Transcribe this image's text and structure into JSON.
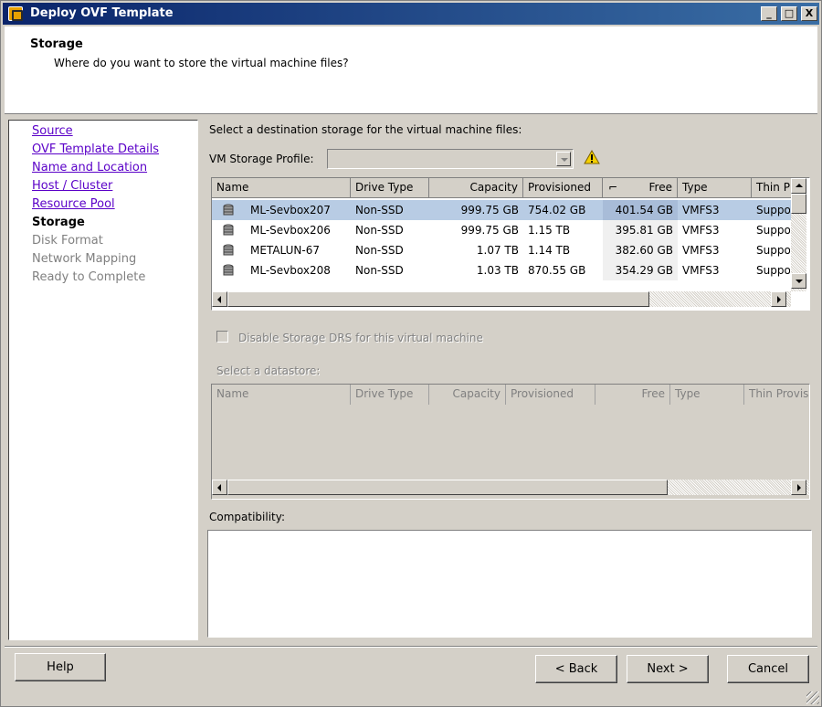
{
  "window": {
    "title": "Deploy OVF Template",
    "controls": [
      "_",
      "□",
      "X"
    ]
  },
  "header": {
    "title": "Storage",
    "subtitle": "Where do you want to store the virtual machine files?"
  },
  "nav": {
    "items": [
      {
        "label": "Source",
        "state": "link"
      },
      {
        "label": "OVF Template Details",
        "state": "link"
      },
      {
        "label": "Name and Location",
        "state": "link"
      },
      {
        "label": "Host / Cluster",
        "state": "link"
      },
      {
        "label": "Resource Pool",
        "state": "link"
      },
      {
        "label": "Storage",
        "state": "current"
      },
      {
        "label": "Disk Format",
        "state": "disabled"
      },
      {
        "label": "Network Mapping",
        "state": "disabled"
      },
      {
        "label": "Ready to Complete",
        "state": "disabled"
      }
    ]
  },
  "main": {
    "prompt": "Select a destination storage for the virtual machine files:",
    "profile_label": "VM Storage Profile:",
    "profile_value": "",
    "warning_icon": "warning-triangle-icon",
    "columns": [
      "Name",
      "Drive Type",
      "Capacity",
      "Provisioned",
      "Free",
      "Type",
      "Thin P"
    ],
    "rows": [
      {
        "name": "ML-Sevbox207",
        "drive": "Non-SSD",
        "capacity": "999.75 GB",
        "provisioned": "754.02 GB",
        "free": "401.54 GB",
        "type": "VMFS3",
        "thin": "Suppo",
        "selected": true
      },
      {
        "name": "ML-Sevbox206",
        "drive": "Non-SSD",
        "capacity": "999.75 GB",
        "provisioned": "1.15 TB",
        "free": "395.81 GB",
        "type": "VMFS3",
        "thin": "Suppo",
        "selected": false
      },
      {
        "name": "METALUN-67",
        "drive": "Non-SSD",
        "capacity": "1.07 TB",
        "provisioned": "1.14 TB",
        "free": "382.60 GB",
        "type": "VMFS3",
        "thin": "Suppo",
        "selected": false
      },
      {
        "name": "ML-Sevbox208",
        "drive": "Non-SSD",
        "capacity": "1.03 TB",
        "provisioned": "870.55 GB",
        "free": "354.29 GB",
        "type": "VMFS3",
        "thin": "Suppo",
        "selected": false
      }
    ],
    "disable_drs_label": "Disable Storage DRS for this virtual machine",
    "select_datastore_label": "Select a datastore:",
    "datastore_columns": [
      "Name",
      "Drive Type",
      "Capacity",
      "Provisioned",
      "Free",
      "Type",
      "Thin Provis"
    ],
    "compatibility_label": "Compatibility:"
  },
  "buttons": {
    "help": "Help",
    "back": "< Back",
    "next": "Next >",
    "cancel": "Cancel"
  }
}
